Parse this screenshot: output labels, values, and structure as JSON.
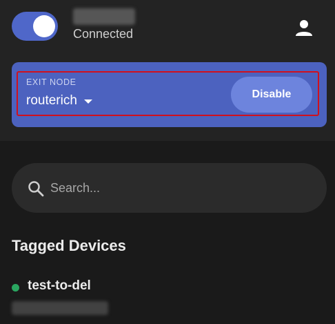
{
  "header": {
    "vpn_toggle": {
      "on": true,
      "accent": "#4f67c9"
    },
    "status": "Connected",
    "account_icon": "person-icon"
  },
  "exit_node": {
    "label": "EXIT NODE",
    "value": "routerich",
    "disable_label": "Disable",
    "card_color": "#4c62bf",
    "highlight_color": "#d0101c"
  },
  "search": {
    "placeholder": "Search...",
    "icon": "search-icon"
  },
  "devices": {
    "section_title": "Tagged Devices",
    "items": [
      {
        "name": "test-to-del",
        "status": "online",
        "status_color": "#2aa660"
      }
    ]
  }
}
